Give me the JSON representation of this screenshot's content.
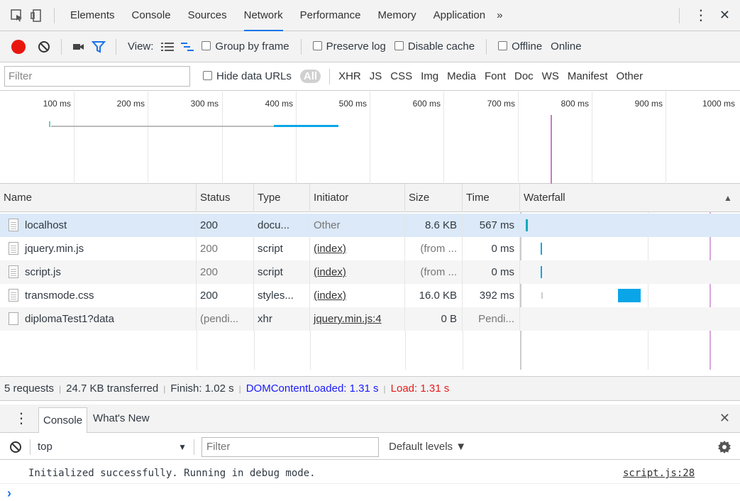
{
  "tabs": [
    {
      "label": "Elements"
    },
    {
      "label": "Console"
    },
    {
      "label": "Sources"
    },
    {
      "label": "Network"
    },
    {
      "label": "Performance"
    },
    {
      "label": "Memory"
    },
    {
      "label": "Application"
    }
  ],
  "tabbar": {
    "more": "»",
    "menu": "⋮",
    "close": "✕"
  },
  "network_toolbar": {
    "view_label": "View:",
    "group_by_frame": "Group by frame",
    "preserve_log": "Preserve log",
    "disable_cache": "Disable cache",
    "offline": "Offline",
    "throttle": "Online"
  },
  "filterbar": {
    "placeholder": "Filter",
    "hide_data_urls": "Hide data URLs",
    "types": [
      "All",
      "XHR",
      "JS",
      "CSS",
      "Img",
      "Media",
      "Font",
      "Doc",
      "WS",
      "Manifest",
      "Other"
    ]
  },
  "overview": {
    "ticks": [
      "100 ms",
      "200 ms",
      "300 ms",
      "400 ms",
      "500 ms",
      "600 ms",
      "700 ms",
      "800 ms",
      "900 ms",
      "1000 ms"
    ]
  },
  "table": {
    "columns": [
      "Name",
      "Status",
      "Type",
      "Initiator",
      "Size",
      "Time",
      "Waterfall"
    ],
    "sort_arrow": "▲",
    "rows": [
      {
        "name": "localhost",
        "status": "200",
        "type": "docu...",
        "initiator": "Other",
        "size": "8.6 KB",
        "time": "567 ms"
      },
      {
        "name": "jquery.min.js",
        "status": "200",
        "type": "script",
        "initiator": "(index)",
        "size": "(from ...",
        "time": "0 ms"
      },
      {
        "name": "script.js",
        "status": "200",
        "type": "script",
        "initiator": "(index)",
        "size": "(from ...",
        "time": "0 ms"
      },
      {
        "name": "transmode.css",
        "status": "200",
        "type": "styles...",
        "initiator": "(index)",
        "size": "16.0 KB",
        "time": "392 ms"
      },
      {
        "name": "diplomaTest1?data",
        "status": "(pendi...",
        "type": "xhr",
        "initiator": "jquery.min.js:4",
        "size": "0 B",
        "time": "Pendi..."
      }
    ]
  },
  "summary": {
    "requests": "5 requests",
    "transferred": "24.7 KB transferred",
    "finish": "Finish: 1.02 s",
    "dom_loaded": "DOMContentLoaded: 1.31 s",
    "load": "Load: 1.31 s"
  },
  "drawer": {
    "tabs": [
      "Console",
      "What's New"
    ],
    "context": "top",
    "filter_placeholder": "Filter",
    "levels": "Default levels ▼",
    "message": "Initialized successfully. Running in debug mode.",
    "source": "script.js:28",
    "prompt": "›"
  },
  "colors": {
    "accent": "#1a73e8",
    "record": "#e8160f",
    "dom_loaded": "#1a1aff",
    "load": "#e81a1a",
    "waterfall_bar": "#0aa5e8",
    "load_line": "#c67ac8"
  }
}
